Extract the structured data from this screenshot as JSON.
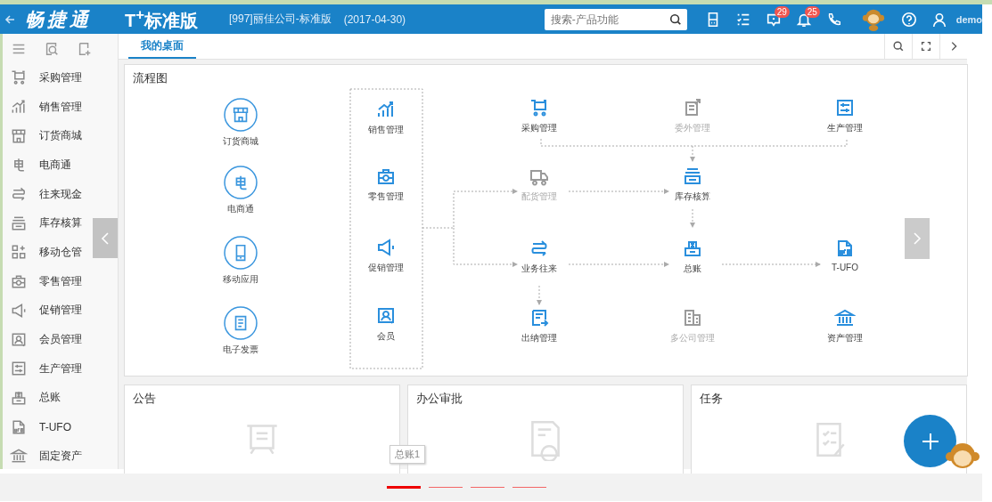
{
  "header": {
    "logo": "畅捷通",
    "product": "T$^{+}$标准版",
    "company": "[997]丽佳公司-标准版",
    "date": "(2017-04-30)",
    "search": {
      "placeholder": "搜索-产品功能"
    },
    "message_badge": "29",
    "notice_badge": "25",
    "user": "demo"
  },
  "sidebar": {
    "items": [
      {
        "label": "采购管理"
      },
      {
        "label": "销售管理"
      },
      {
        "label": "订货商城"
      },
      {
        "label": "电商通"
      },
      {
        "label": "往来现金"
      },
      {
        "label": "库存核算"
      },
      {
        "label": "移动仓管"
      },
      {
        "label": "零售管理"
      },
      {
        "label": "促销管理"
      },
      {
        "label": "会员管理"
      },
      {
        "label": "生产管理"
      },
      {
        "label": "总账"
      },
      {
        "label": "T-UFO"
      },
      {
        "label": "固定资产"
      }
    ]
  },
  "tabs": [
    {
      "label": "我的桌面",
      "selected": true
    }
  ],
  "flow": {
    "title": "流程图",
    "entry_nodes": [
      {
        "label": "订货商城"
      },
      {
        "label": "电商通"
      },
      {
        "label": "移动应用"
      },
      {
        "label": "电子发票"
      }
    ],
    "group_nodes": [
      {
        "label": "销售管理"
      },
      {
        "label": "零售管理"
      },
      {
        "label": "促销管理"
      },
      {
        "label": "会员"
      }
    ],
    "nodes": [
      {
        "label": "采购管理",
        "disabled": false
      },
      {
        "label": "委外管理",
        "disabled": true
      },
      {
        "label": "生产管理",
        "disabled": false
      },
      {
        "label": "配货管理",
        "disabled": true
      },
      {
        "label": "库存核算",
        "disabled": false
      },
      {
        "label": "业务往来",
        "disabled": false
      },
      {
        "label": "总账",
        "disabled": false
      },
      {
        "label": "T-UFO",
        "disabled": false
      },
      {
        "label": "出纳管理",
        "disabled": false
      },
      {
        "label": "多公司管理",
        "disabled": true
      },
      {
        "label": "资产管理",
        "disabled": false
      }
    ]
  },
  "panels": [
    {
      "title": "公告"
    },
    {
      "title": "办公审批"
    },
    {
      "title": "任务"
    }
  ],
  "tooltip": "总账1",
  "pages": [
    {
      "selected": true
    },
    {
      "selected": false
    },
    {
      "selected": false
    },
    {
      "selected": false
    }
  ]
}
